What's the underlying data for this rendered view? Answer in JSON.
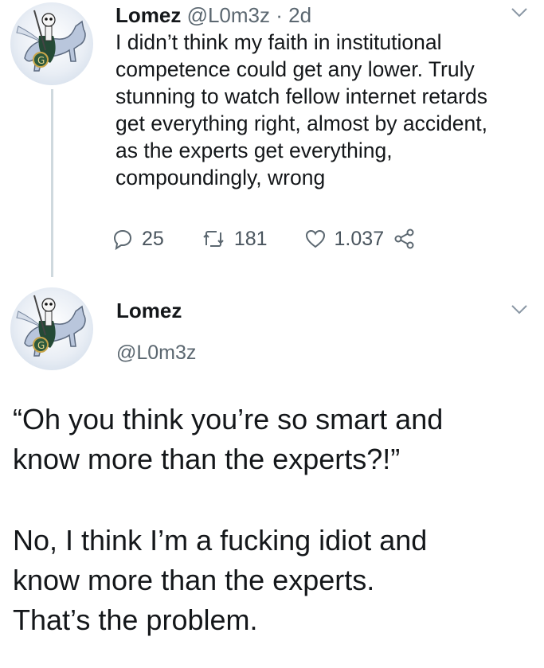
{
  "tweet1": {
    "display_name": "Lomez",
    "handle": "@L0m3z",
    "separator": " · ",
    "time": "2d",
    "text_lines": [
      "I didn’t think my faith in institutional",
      "competence could get any lower. Truly",
      "stunning to watch fellow internet retards",
      "get everything right, almost by accident,",
      "as the experts get everything,",
      "compoundingly, wrong"
    ],
    "replies": "25",
    "retweets": "181",
    "likes": "1.037",
    "icons": {
      "reply": "reply-icon",
      "retweet": "retweet-icon",
      "like": "heart-icon",
      "share": "share-icon",
      "menu": "chevron-down-icon"
    }
  },
  "tweet2": {
    "display_name": "Lomez",
    "handle": "@L0m3z",
    "paragraph1": [
      "“Oh you think you’re so smart and",
      "know more than the experts?!”"
    ],
    "paragraph2": [
      "No, I think I’m a fucking idiot and",
      "know more than the experts.",
      "That’s the problem."
    ]
  },
  "colors": {
    "text": "#14171a",
    "secondary": "#5b6770",
    "thread_line": "#cfd9de",
    "avatar_horse": "#b9c6dc",
    "avatar_cloak": "#244a36"
  }
}
